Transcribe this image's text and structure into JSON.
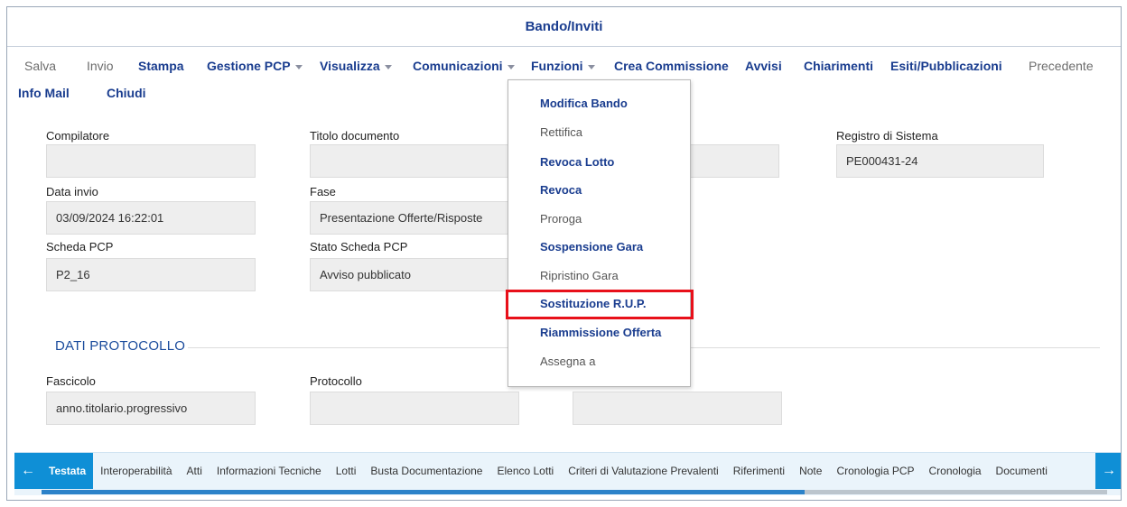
{
  "header": {
    "title": "Bando/Inviti"
  },
  "toolbar": {
    "row1": [
      {
        "label": "Salva",
        "enabled": false,
        "dropdown": false
      },
      {
        "label": "Invio",
        "enabled": false,
        "dropdown": false
      },
      {
        "label": "Stampa",
        "enabled": true,
        "dropdown": false
      },
      {
        "label": "Gestione PCP",
        "enabled": true,
        "dropdown": true
      },
      {
        "label": "Visualizza",
        "enabled": true,
        "dropdown": true
      },
      {
        "label": "Comunicazioni",
        "enabled": true,
        "dropdown": true
      },
      {
        "label": "Funzioni",
        "enabled": true,
        "dropdown": true
      },
      {
        "label": "Crea Commissione",
        "enabled": true,
        "dropdown": false
      },
      {
        "label": "Avvisi",
        "enabled": true,
        "dropdown": false
      },
      {
        "label": "Chiarimenti",
        "enabled": true,
        "dropdown": false
      },
      {
        "label": "Esiti/Pubblicazioni",
        "enabled": true,
        "dropdown": false
      },
      {
        "label": "Precedente",
        "enabled": false,
        "dropdown": false
      }
    ],
    "row2": [
      {
        "label": "Info Mail",
        "enabled": true
      },
      {
        "label": "Chiudi",
        "enabled": true
      }
    ]
  },
  "form": {
    "compilatore": {
      "label": "Compilatore",
      "value": ""
    },
    "titolo": {
      "label": "Titolo documento",
      "value": ""
    },
    "registro": {
      "label": "Registro di Sistema",
      "value": "PE000431-24"
    },
    "data_invio": {
      "label": "Data invio",
      "value": "03/09/2024 16:22:01"
    },
    "fase": {
      "label": "Fase",
      "value": "Presentazione Offerte/Risposte"
    },
    "scheda": {
      "label": "Scheda PCP",
      "value": "P2_16"
    },
    "stato": {
      "label": "Stato Scheda PCP",
      "value": "Avviso pubblicato"
    }
  },
  "protocollo": {
    "section_title": "DATI PROTOCOLLO",
    "fascicolo": {
      "label": "Fascicolo",
      "value": "anno.titolario.progressivo"
    },
    "protocollo": {
      "label": "Protocollo",
      "value": ""
    },
    "data_protocollo": {
      "value": ""
    }
  },
  "menu": {
    "items": [
      {
        "label": "Modifica Bando",
        "enabled": true
      },
      {
        "label": "Rettifica",
        "enabled": false
      },
      {
        "label": "Revoca Lotto",
        "enabled": true
      },
      {
        "label": "Revoca",
        "enabled": true
      },
      {
        "label": "Proroga",
        "enabled": false
      },
      {
        "label": "Sospensione Gara",
        "enabled": true
      },
      {
        "label": "Ripristino Gara",
        "enabled": false
      },
      {
        "label": "Sostituzione R.U.P.",
        "enabled": true,
        "highlighted": true
      },
      {
        "label": "Riammissione Offerta",
        "enabled": true
      },
      {
        "label": "Assegna a",
        "enabled": false
      }
    ],
    "highlight_color": "#e8101a"
  },
  "tabs": {
    "items": [
      "Testata",
      "Interoperabilità",
      "Atti",
      "Informazioni Tecniche",
      "Lotti",
      "Busta Documentazione",
      "Elenco Lotti",
      "Criteri di Valutazione Prevalenti",
      "Riferimenti",
      "Note",
      "Cronologia PCP",
      "Cronologia",
      "Documenti"
    ],
    "active": "Testata",
    "accent": "#0f8fd6"
  },
  "icons": {
    "left_arrow": "arrow-left-icon",
    "right_arrow": "arrow-right-icon",
    "caret": "chevron-down-icon"
  }
}
